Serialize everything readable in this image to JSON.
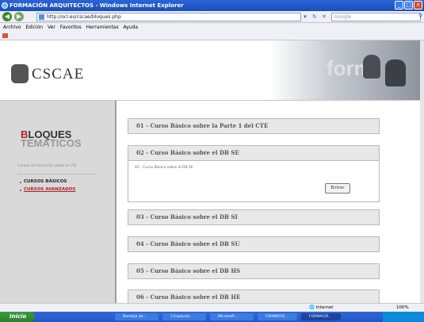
{
  "window": {
    "title": "FORMACIÓN ARQUITECTOS - Windows Internet Explorer",
    "controls": [
      "_",
      "□",
      "×"
    ]
  },
  "navbar": {
    "back": "◀",
    "forward": "▶",
    "address": "http://ocl.es/cscae/bloques.php",
    "search_placeholder": "Google"
  },
  "menu": [
    "Archivo",
    "Edición",
    "Ver",
    "Favoritos",
    "Herramientas",
    "Ayuda"
  ],
  "header": {
    "logo_text": "CSCAE",
    "banner_word": "form"
  },
  "sidebar": {
    "heading_red": "B",
    "heading_rest": "LOQUES",
    "heading2": "TEMÁTICOS",
    "subtitle": "Cursos de Iniciación sobre el CTE",
    "links": [
      {
        "label": "CURSOS BÁSICOS",
        "color": "#222222"
      },
      {
        "label": "CURSOS AVANZADOS",
        "color": "#b21e2a"
      }
    ]
  },
  "courses": [
    {
      "title": "01 - Curso Básico sobre la Parte 1 del CTE"
    },
    {
      "title": "02 - Curso Básico sobre el DB SE"
    },
    {
      "title": "03 - Curso Básico sobre el DB SI"
    },
    {
      "title": "04 - Curso Básico sobre el DB SU"
    },
    {
      "title": "05 - Curso Básico sobre el DB HS"
    },
    {
      "title": "06 - Curso Básico sobre el DB HE"
    }
  ],
  "expanded": {
    "description": "02 - Curso Básico sobre el DB SE",
    "button": "Entrar"
  },
  "statusbar": {
    "zone": "Internet",
    "zoom": "100%"
  },
  "taskbar": {
    "start": "Inicio",
    "tasks": [
      "Bandeja de...",
      "3 Explorad...",
      "Microsoft...",
      "FORMACIÓ...",
      "FORMACIÓ..."
    ]
  }
}
